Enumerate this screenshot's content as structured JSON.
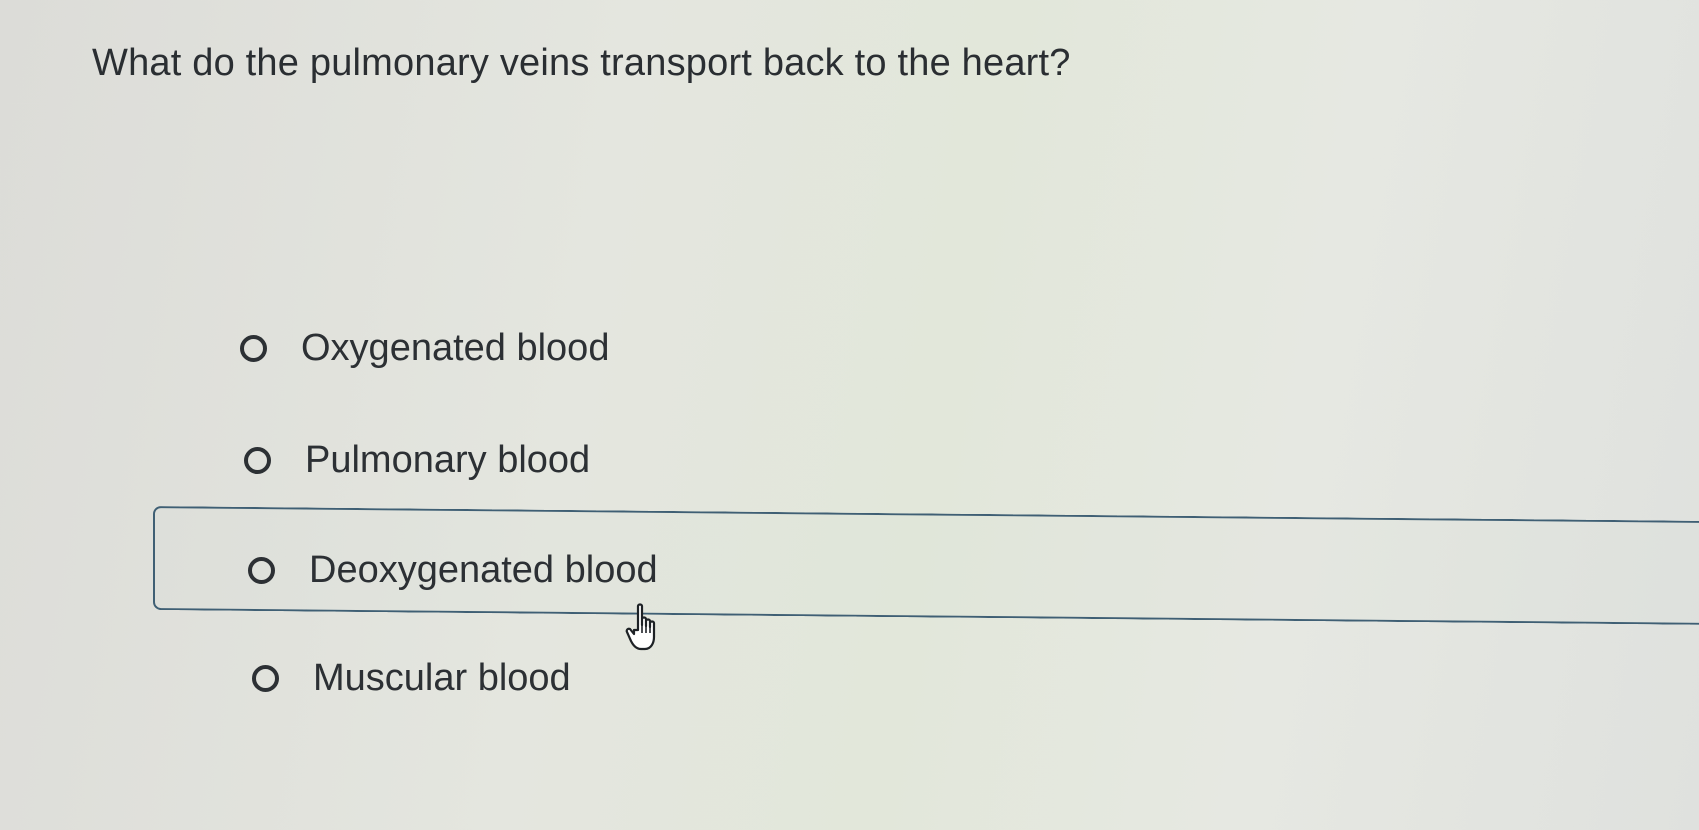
{
  "question": {
    "text": "What do the pulmonary veins transport back to the heart?"
  },
  "options": [
    {
      "label": "Oxygenated blood",
      "selected": false
    },
    {
      "label": "Pulmonary blood",
      "selected": false
    },
    {
      "label": "Deoxygenated blood",
      "selected": false,
      "hovered": true
    },
    {
      "label": "Muscular blood",
      "selected": false
    }
  ],
  "icons": {
    "radio": "radio-unchecked-icon",
    "cursor": "hand-pointer-cursor-icon"
  },
  "colors": {
    "text": "#2c3034",
    "hover_border": "#3f5f74",
    "background": "#e2e5de"
  }
}
